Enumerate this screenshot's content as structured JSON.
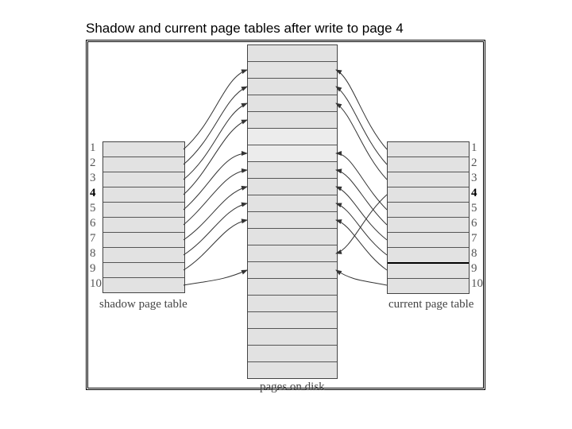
{
  "title": "Shadow and current page tables after write to page 4",
  "shadow": {
    "label": "shadow page table",
    "numbers": [
      "1",
      "2",
      "3",
      "4",
      "5",
      "6",
      "7",
      "8",
      "9",
      "10"
    ]
  },
  "current": {
    "label": "current page table",
    "numbers": [
      "1",
      "2",
      "3",
      "4",
      "5",
      "6",
      "7",
      "8",
      "9",
      "10"
    ]
  },
  "disk": {
    "label": "pages on disk"
  }
}
